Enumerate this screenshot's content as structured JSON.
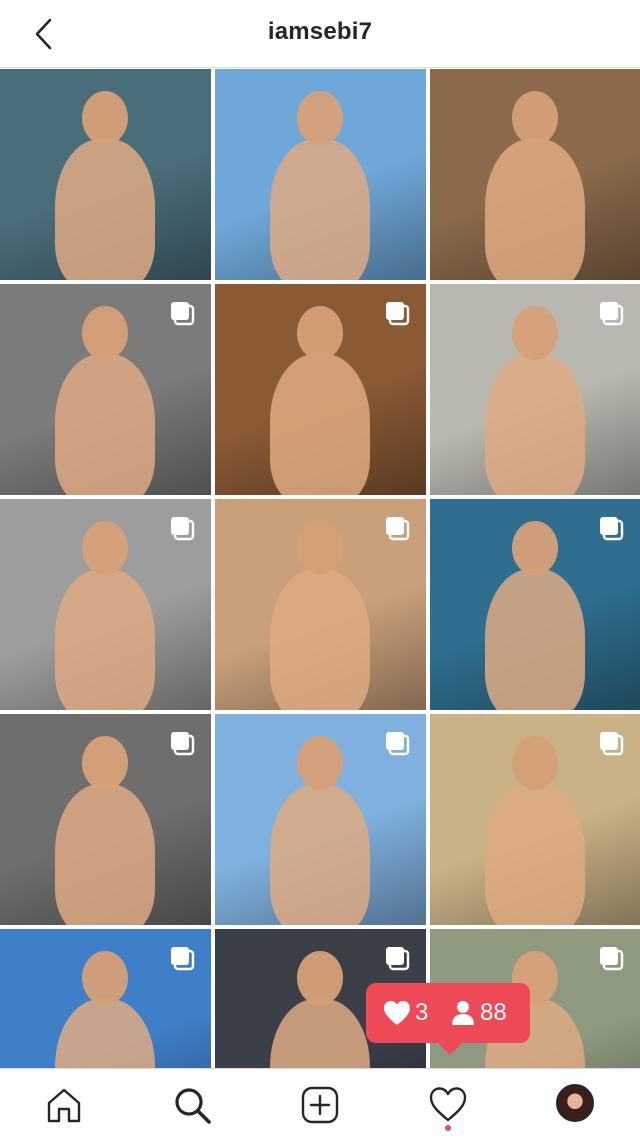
{
  "header": {
    "username": "iamsebi7",
    "back_icon": "chevron-left-icon"
  },
  "grid": {
    "tiles": [
      {
        "label": "post-1",
        "multi": false,
        "bg": "#4a6d7a"
      },
      {
        "label": "post-2",
        "multi": false,
        "bg": "#6fa7d8"
      },
      {
        "label": "post-3",
        "multi": false,
        "bg": "#8a6a4a"
      },
      {
        "label": "post-4",
        "multi": true,
        "bg": "#7b7b7b"
      },
      {
        "label": "post-5",
        "multi": true,
        "bg": "#8a5a35"
      },
      {
        "label": "post-6",
        "multi": true,
        "bg": "#b8b8b0"
      },
      {
        "label": "post-7",
        "multi": true,
        "bg": "#9d9d9d"
      },
      {
        "label": "post-8",
        "multi": true,
        "bg": "#c9a07a"
      },
      {
        "label": "post-9",
        "multi": true,
        "bg": "#2f6e8e"
      },
      {
        "label": "post-10",
        "multi": true,
        "bg": "#6e6e6e"
      },
      {
        "label": "post-11",
        "multi": true,
        "bg": "#7fb0de"
      },
      {
        "label": "post-12",
        "multi": true,
        "bg": "#c9b285"
      },
      {
        "label": "post-13",
        "multi": true,
        "bg": "#3f7fc7"
      },
      {
        "label": "post-14",
        "multi": true,
        "bg": "#3b3f48"
      },
      {
        "label": "post-15",
        "multi": true,
        "bg": "#8d9a80"
      }
    ]
  },
  "activity_toast": {
    "likes_count": "3",
    "followers_count": "88",
    "color": "#ed4956"
  },
  "tabbar": {
    "items": [
      {
        "name": "home-icon"
      },
      {
        "name": "search-icon"
      },
      {
        "name": "new-post-icon"
      },
      {
        "name": "heart-icon"
      },
      {
        "name": "profile-avatar"
      }
    ]
  }
}
